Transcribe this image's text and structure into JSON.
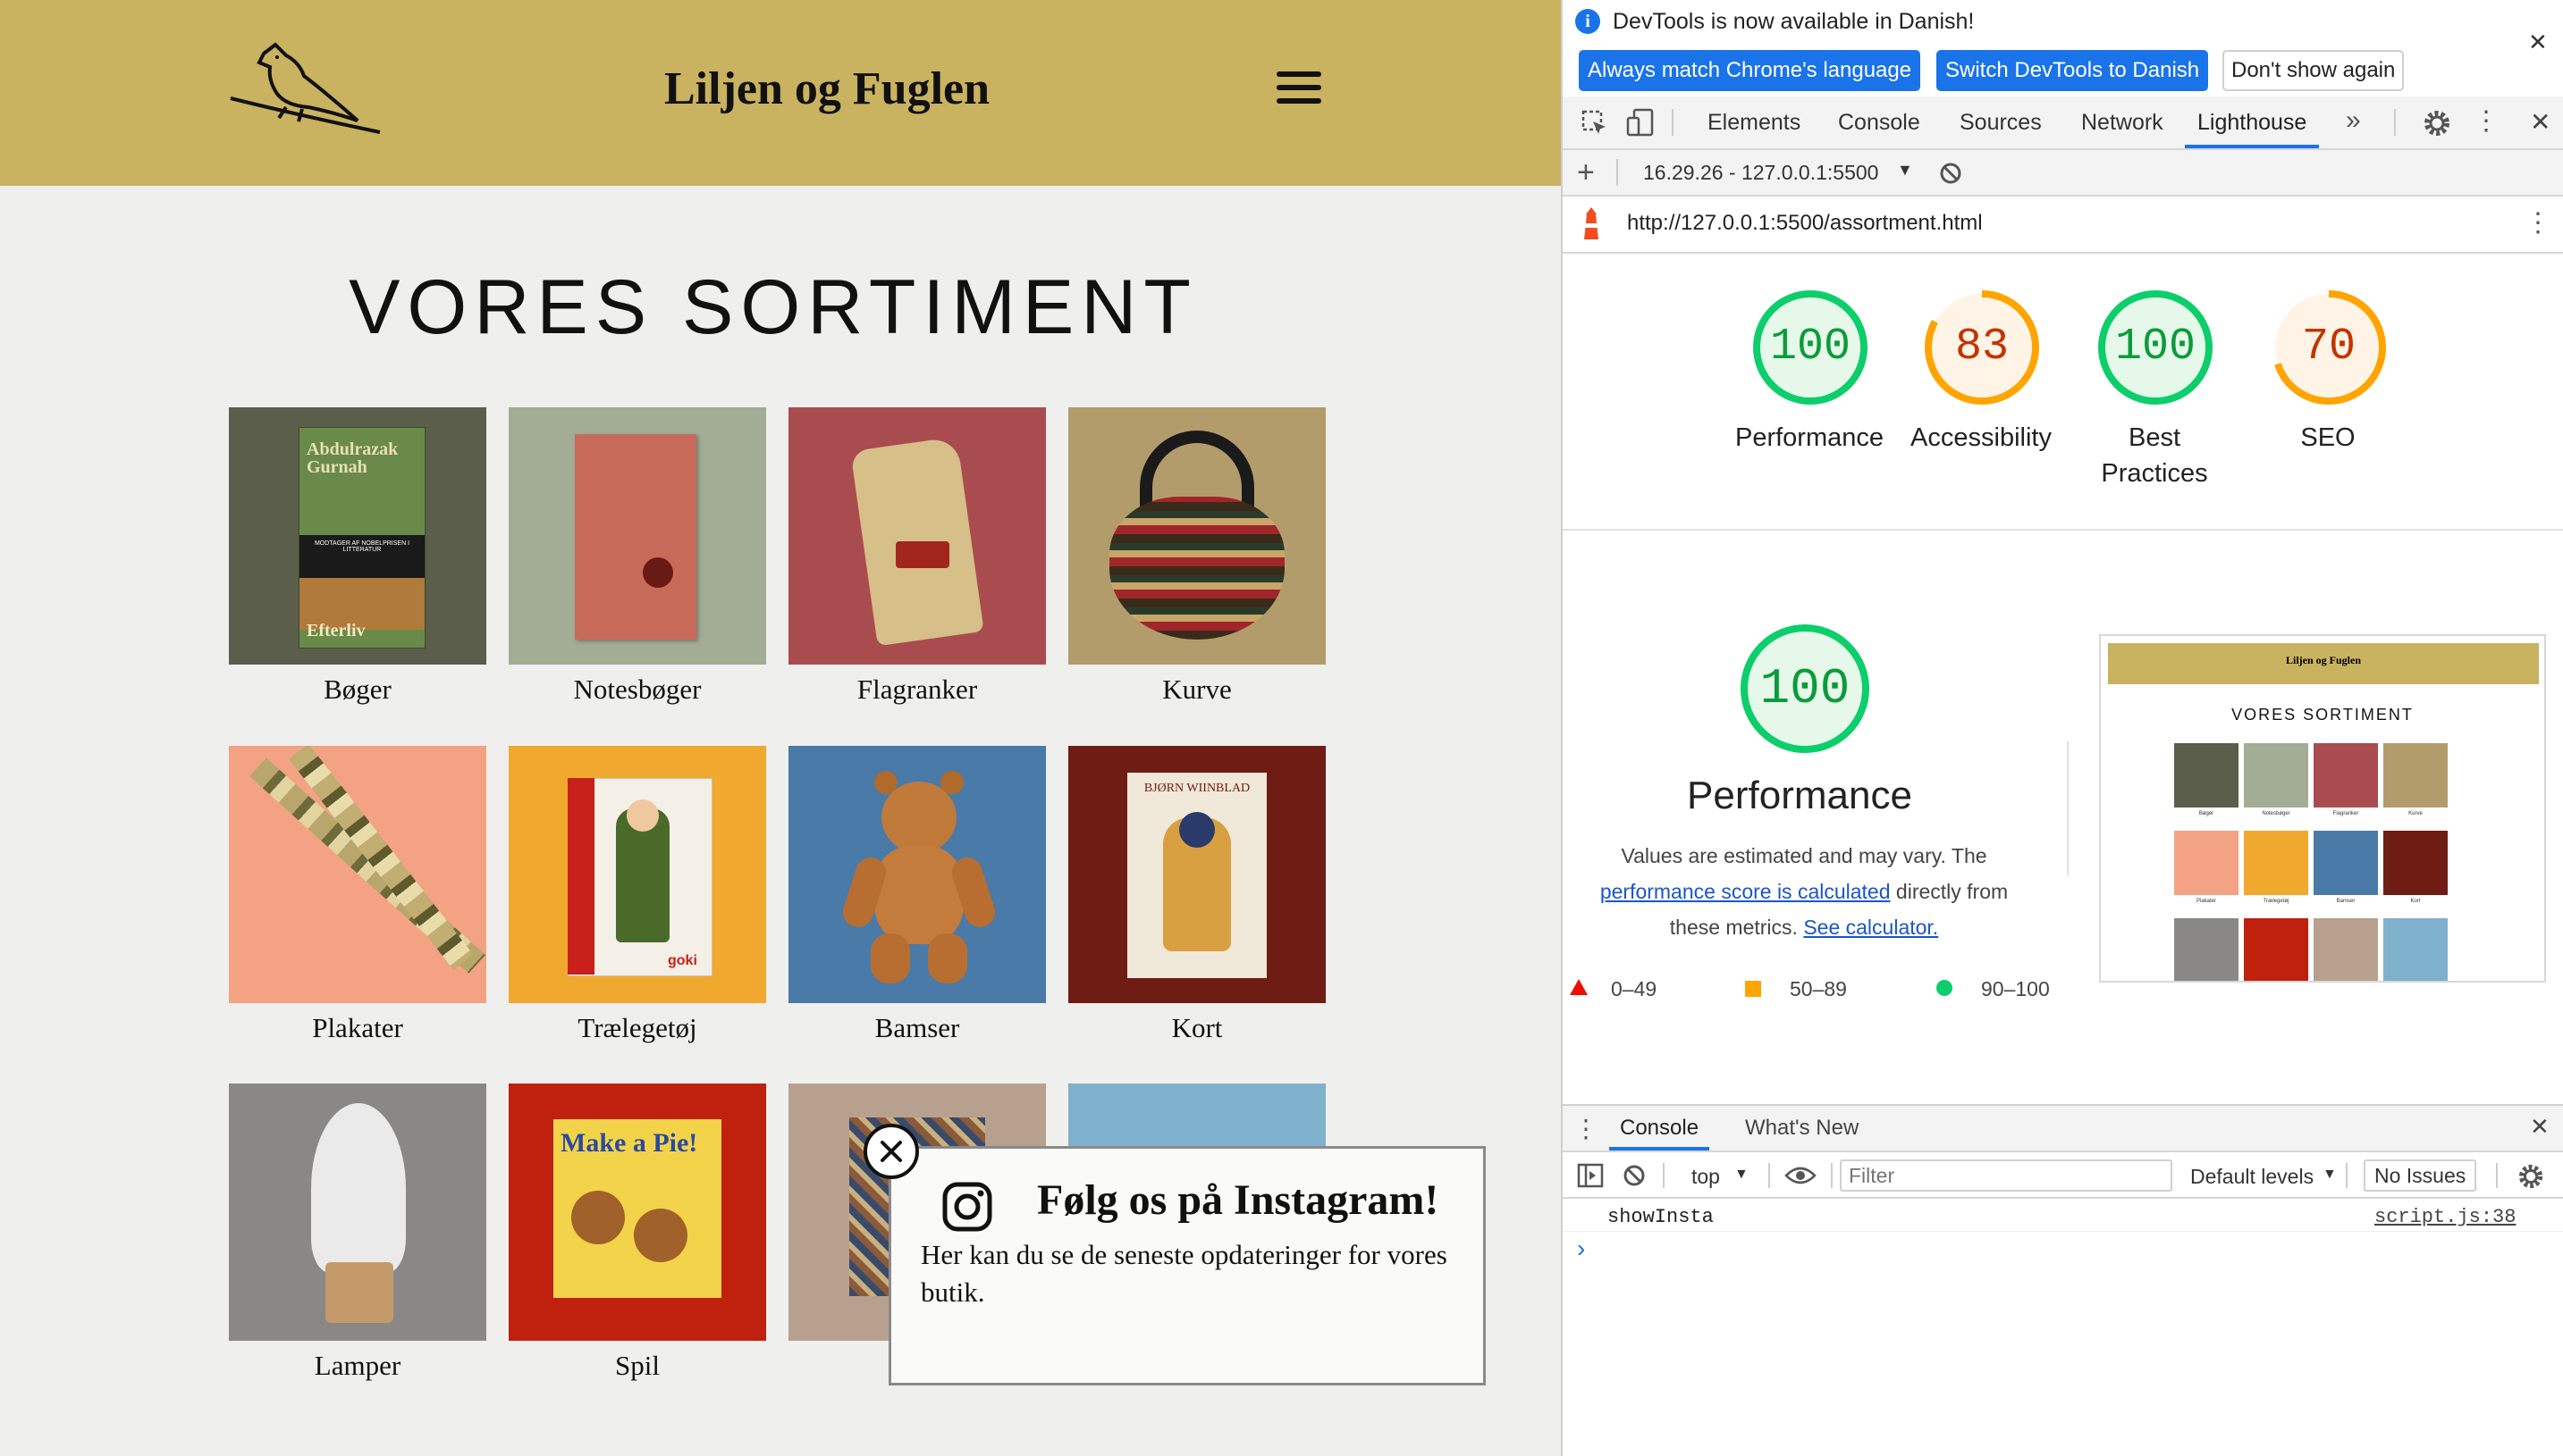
{
  "site": {
    "title": "Liljen og Fuglen",
    "heading": "VORES SORTIMENT",
    "products": [
      {
        "label": "Bøger",
        "color": "#5a5e4a"
      },
      {
        "label": "Notesbøger",
        "color": "#a3ad95"
      },
      {
        "label": "Flagranker",
        "color": "#a94c50"
      },
      {
        "label": "Kurve",
        "color": "#b39c6c"
      },
      {
        "label": "Plakater",
        "color": "#f3a384"
      },
      {
        "label": "Trælegetøj",
        "color": "#f0a92e"
      },
      {
        "label": "Bamser",
        "color": "#4a7aa8"
      },
      {
        "label": "Kort",
        "color": "#6e1c14"
      },
      {
        "label": "Lamper",
        "color": "#8a8886"
      },
      {
        "label": "Spil",
        "color": "#c0200e"
      },
      {
        "label": "",
        "color": "#b8a08e"
      },
      {
        "label": "",
        "color": "#7fb0cc"
      }
    ],
    "book_cover": {
      "author": "Abdulrazak Gurnah",
      "title": "Efterliv",
      "badge": "MODTAGER AF NOBELPRISEN I LITTERATUR"
    },
    "card_text": "BJØRN WIINBLAD",
    "game_text": "Make a Pie!",
    "toy_text": "goki",
    "popup": {
      "title": "Følg os på Instagram!",
      "text": "Her kan du se de seneste opdateringer for vores butik."
    }
  },
  "devtools": {
    "info_message": "DevTools is now available in Danish!",
    "buttons": {
      "match": "Always match Chrome's language",
      "switch": "Switch DevTools to Danish",
      "dismiss": "Don't show again"
    },
    "tabs": [
      "Elements",
      "Console",
      "Sources",
      "Network",
      "Lighthouse"
    ],
    "active_tab": "Lighthouse",
    "report_selector": "16.29.26 - 127.0.0.1:5500",
    "url": "http://127.0.0.1:5500/assortment.html",
    "scores": [
      {
        "label": "Performance",
        "value": 100,
        "color": "#0c9b3b"
      },
      {
        "label": "Accessibility",
        "value": 83,
        "color": "#c33300"
      },
      {
        "label": "Best Practices",
        "value": 100,
        "color": "#0c9b3b"
      },
      {
        "label": "SEO",
        "value": 70,
        "color": "#c33300"
      }
    ],
    "performance": {
      "score": 100,
      "title": "Performance",
      "desc_1": "Values are estimated and may vary. The",
      "link_1": "performance score is calculated",
      "desc_2": "directly from these metrics.",
      "link_2": "See calculator."
    },
    "legend": [
      "0–49",
      "50–89",
      "90–100"
    ],
    "preview": {
      "title": "Liljen og Fuglen",
      "heading": "VORES SORTIMENT"
    },
    "drawer": {
      "tabs": [
        "Console",
        "What's New"
      ],
      "context": "top",
      "filter_placeholder": "Filter",
      "levels": "Default levels",
      "issues": "No Issues",
      "log_message": "showInsta",
      "log_source": "script.js:38",
      "prompt": "›"
    }
  }
}
